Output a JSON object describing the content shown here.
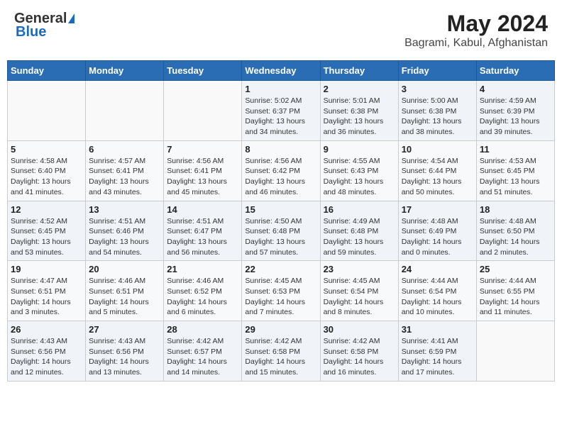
{
  "logo": {
    "general": "General",
    "blue": "Blue"
  },
  "title": "May 2024",
  "subtitle": "Bagrami, Kabul, Afghanistan",
  "days_of_week": [
    "Sunday",
    "Monday",
    "Tuesday",
    "Wednesday",
    "Thursday",
    "Friday",
    "Saturday"
  ],
  "weeks": [
    [
      {
        "day": "",
        "info": ""
      },
      {
        "day": "",
        "info": ""
      },
      {
        "day": "",
        "info": ""
      },
      {
        "day": "1",
        "info": "Sunrise: 5:02 AM\nSunset: 6:37 PM\nDaylight: 13 hours and 34 minutes."
      },
      {
        "day": "2",
        "info": "Sunrise: 5:01 AM\nSunset: 6:38 PM\nDaylight: 13 hours and 36 minutes."
      },
      {
        "day": "3",
        "info": "Sunrise: 5:00 AM\nSunset: 6:38 PM\nDaylight: 13 hours and 38 minutes."
      },
      {
        "day": "4",
        "info": "Sunrise: 4:59 AM\nSunset: 6:39 PM\nDaylight: 13 hours and 39 minutes."
      }
    ],
    [
      {
        "day": "5",
        "info": "Sunrise: 4:58 AM\nSunset: 6:40 PM\nDaylight: 13 hours and 41 minutes."
      },
      {
        "day": "6",
        "info": "Sunrise: 4:57 AM\nSunset: 6:41 PM\nDaylight: 13 hours and 43 minutes."
      },
      {
        "day": "7",
        "info": "Sunrise: 4:56 AM\nSunset: 6:41 PM\nDaylight: 13 hours and 45 minutes."
      },
      {
        "day": "8",
        "info": "Sunrise: 4:56 AM\nSunset: 6:42 PM\nDaylight: 13 hours and 46 minutes."
      },
      {
        "day": "9",
        "info": "Sunrise: 4:55 AM\nSunset: 6:43 PM\nDaylight: 13 hours and 48 minutes."
      },
      {
        "day": "10",
        "info": "Sunrise: 4:54 AM\nSunset: 6:44 PM\nDaylight: 13 hours and 50 minutes."
      },
      {
        "day": "11",
        "info": "Sunrise: 4:53 AM\nSunset: 6:45 PM\nDaylight: 13 hours and 51 minutes."
      }
    ],
    [
      {
        "day": "12",
        "info": "Sunrise: 4:52 AM\nSunset: 6:45 PM\nDaylight: 13 hours and 53 minutes."
      },
      {
        "day": "13",
        "info": "Sunrise: 4:51 AM\nSunset: 6:46 PM\nDaylight: 13 hours and 54 minutes."
      },
      {
        "day": "14",
        "info": "Sunrise: 4:51 AM\nSunset: 6:47 PM\nDaylight: 13 hours and 56 minutes."
      },
      {
        "day": "15",
        "info": "Sunrise: 4:50 AM\nSunset: 6:48 PM\nDaylight: 13 hours and 57 minutes."
      },
      {
        "day": "16",
        "info": "Sunrise: 4:49 AM\nSunset: 6:48 PM\nDaylight: 13 hours and 59 minutes."
      },
      {
        "day": "17",
        "info": "Sunrise: 4:48 AM\nSunset: 6:49 PM\nDaylight: 14 hours and 0 minutes."
      },
      {
        "day": "18",
        "info": "Sunrise: 4:48 AM\nSunset: 6:50 PM\nDaylight: 14 hours and 2 minutes."
      }
    ],
    [
      {
        "day": "19",
        "info": "Sunrise: 4:47 AM\nSunset: 6:51 PM\nDaylight: 14 hours and 3 minutes."
      },
      {
        "day": "20",
        "info": "Sunrise: 4:46 AM\nSunset: 6:51 PM\nDaylight: 14 hours and 5 minutes."
      },
      {
        "day": "21",
        "info": "Sunrise: 4:46 AM\nSunset: 6:52 PM\nDaylight: 14 hours and 6 minutes."
      },
      {
        "day": "22",
        "info": "Sunrise: 4:45 AM\nSunset: 6:53 PM\nDaylight: 14 hours and 7 minutes."
      },
      {
        "day": "23",
        "info": "Sunrise: 4:45 AM\nSunset: 6:54 PM\nDaylight: 14 hours and 8 minutes."
      },
      {
        "day": "24",
        "info": "Sunrise: 4:44 AM\nSunset: 6:54 PM\nDaylight: 14 hours and 10 minutes."
      },
      {
        "day": "25",
        "info": "Sunrise: 4:44 AM\nSunset: 6:55 PM\nDaylight: 14 hours and 11 minutes."
      }
    ],
    [
      {
        "day": "26",
        "info": "Sunrise: 4:43 AM\nSunset: 6:56 PM\nDaylight: 14 hours and 12 minutes."
      },
      {
        "day": "27",
        "info": "Sunrise: 4:43 AM\nSunset: 6:56 PM\nDaylight: 14 hours and 13 minutes."
      },
      {
        "day": "28",
        "info": "Sunrise: 4:42 AM\nSunset: 6:57 PM\nDaylight: 14 hours and 14 minutes."
      },
      {
        "day": "29",
        "info": "Sunrise: 4:42 AM\nSunset: 6:58 PM\nDaylight: 14 hours and 15 minutes."
      },
      {
        "day": "30",
        "info": "Sunrise: 4:42 AM\nSunset: 6:58 PM\nDaylight: 14 hours and 16 minutes."
      },
      {
        "day": "31",
        "info": "Sunrise: 4:41 AM\nSunset: 6:59 PM\nDaylight: 14 hours and 17 minutes."
      },
      {
        "day": "",
        "info": ""
      }
    ]
  ]
}
